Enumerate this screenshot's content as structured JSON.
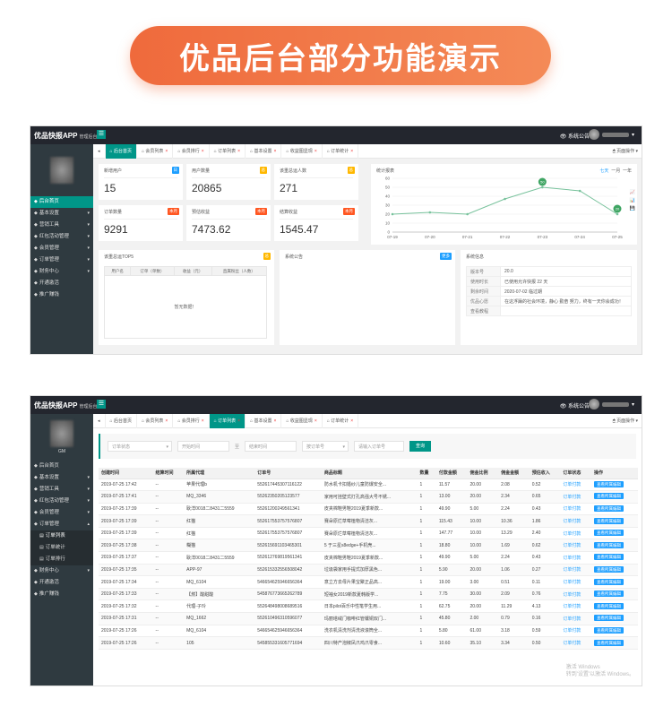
{
  "banner": {
    "title": "优品后台部分功能演示"
  },
  "app": {
    "brand": "优品快报APP",
    "brand_sub": "管理后台",
    "notice": "系统公告",
    "page_ops": "页面操作"
  },
  "sidebar1": {
    "items": [
      {
        "label": "后台首页",
        "active": true
      },
      {
        "label": "基本设置"
      },
      {
        "label": "营销工具"
      },
      {
        "label": "红包活动管理"
      },
      {
        "label": "会员管理"
      },
      {
        "label": "订单管理"
      },
      {
        "label": "财务中心"
      },
      {
        "label": "开通激活"
      },
      {
        "label": "推广赚钱"
      }
    ]
  },
  "tabs1": [
    {
      "label": "后台首页",
      "active": true
    },
    {
      "label": "会员列表"
    },
    {
      "label": "会员排行"
    },
    {
      "label": "订单列表"
    },
    {
      "label": "基本设置"
    },
    {
      "label": "收益图显现"
    },
    {
      "label": "订单统计"
    }
  ],
  "stats": [
    {
      "title": "新增用户",
      "badge": "日",
      "badge_color": "#1e9fff",
      "value": "15"
    },
    {
      "title": "用户数量",
      "badge": "总",
      "badge_color": "#ffb800",
      "value": "20865"
    },
    {
      "title": "该重总运人数",
      "badge": "总",
      "badge_color": "#ffb800",
      "value": "271"
    },
    {
      "title": "订单数量",
      "badge": "本月",
      "badge_color": "#ff5722",
      "value": "9291"
    },
    {
      "title": "预估收益",
      "badge": "本月",
      "badge_color": "#ff5722",
      "value": "7473.62"
    },
    {
      "title": "结算收益",
      "badge": "本月",
      "badge_color": "#ff5722",
      "value": "1545.47"
    }
  ],
  "chart_panel": {
    "title": "统计报表",
    "ranges": [
      "七天",
      "一月",
      "一年"
    ]
  },
  "chart_data": {
    "type": "line",
    "title": "",
    "x": [
      "07-19",
      "07-20",
      "07-21",
      "07-22",
      "07-23",
      "07-24",
      "07-25"
    ],
    "series": [
      {
        "values": [
          20,
          22,
          20,
          37,
          50,
          46,
          20
        ]
      }
    ],
    "point_labels": {
      "4": "50",
      "6": "20"
    },
    "ylim": [
      0,
      60
    ],
    "yticks": [
      0,
      10,
      20,
      30,
      40,
      50,
      60
    ],
    "grid": true,
    "color": "#78c29c"
  },
  "top5": {
    "title": "该重总运TOP5",
    "badge": "总",
    "columns": [
      "用户名",
      "订单（单数）",
      "收益（元）",
      "直属粉丝（人数）"
    ],
    "empty": "暂无数据！"
  },
  "notice_panel": {
    "title": "系统公告",
    "more": "更多"
  },
  "sys_info": {
    "title": "系统信息",
    "rows": [
      {
        "k": "版本号",
        "v": "20.0"
      },
      {
        "k": "使用时长",
        "v": "已使用允许快报 22 天",
        "red": "22 天"
      },
      {
        "k": "剩余时间",
        "v": "2020-07-02 临过期",
        "is_red": true
      },
      {
        "k": "优品心愿",
        "v": "在这浮躁的社会环境，静心 勤奋 努力，终有一天你会成功！"
      },
      {
        "k": "查看教程",
        "v": ""
      }
    ]
  },
  "sidebar2": {
    "user": "GM",
    "items": [
      {
        "label": "后台首页"
      },
      {
        "label": "基本设置"
      },
      {
        "label": "营销工具"
      },
      {
        "label": "红包活动管理"
      },
      {
        "label": "会员管理"
      },
      {
        "label": "订单管理",
        "open": true
      },
      {
        "label": "订单列表",
        "sub": true,
        "active": true
      },
      {
        "label": "订单统计",
        "sub": true
      },
      {
        "label": "订单排行",
        "sub": true
      },
      {
        "label": "财务中心"
      },
      {
        "label": "开通激活"
      },
      {
        "label": "推广赚钱"
      }
    ]
  },
  "tabs2": [
    {
      "label": "后台首页"
    },
    {
      "label": "会员列表"
    },
    {
      "label": "会员排行"
    },
    {
      "label": "订单列表",
      "active": true
    },
    {
      "label": "基本设置"
    },
    {
      "label": "收益图显现"
    },
    {
      "label": "订单统计"
    }
  ],
  "filters": {
    "status": "订单状态",
    "start": "开始时间",
    "sep": "至",
    "end": "结束时间",
    "order_no": "按订单号",
    "keyword_ph": "请输入订单号",
    "search": "查询"
  },
  "orders": {
    "columns": [
      "创建时间",
      "结算时间",
      "所属代理",
      "订单号",
      "商品标题",
      "数量",
      "付款金额",
      "佣金比例",
      "佣金金额",
      "预估收入",
      "订单状态",
      "操作"
    ],
    "rows": [
      [
        "2019-07-25 17:42",
        "--",
        "苹果代理b",
        "5526174453071161​22",
        "防水机卡扣婚纱儿童防爆安全...",
        "1",
        "11.57",
        "20.00",
        "2.08",
        "0.52",
        "订单付款",
        "查看所属编辑"
      ],
      [
        "2019-07-25 17:41",
        "--",
        "MQ_3346",
        "552623502051​23577",
        "家用可挂壁式打孔高强大号不锈...",
        "1",
        "13.00",
        "20.00",
        "2.34",
        "0.65",
        "订单付款",
        "查看所属编辑"
      ],
      [
        "2019-07-25 17:39",
        "--",
        "耿洋0018二8431二5559",
        "5526120024956​1341",
        "皮夹棉鞋男鞋2019夏季新款...",
        "1",
        "49.90",
        "5.00",
        "2.24",
        "0.43",
        "订单付款",
        "查看所属编辑"
      ],
      [
        "2019-07-25 17:39",
        "--",
        "红猫",
        "5526175537575​76807",
        "赛朵原烂草莓植物清洁灰...",
        "1",
        "115.43",
        "10.00",
        "10.36",
        "1.86",
        "订单付款",
        "查看所属编辑"
      ],
      [
        "2019-07-25 17:39",
        "--",
        "红猫",
        "5526175537575​76807",
        "赛朵原烂草莓植物清洁灰...",
        "1",
        "147.77",
        "10.00",
        "13.29",
        "2.40",
        "订单付款",
        "查看所属编辑"
      ],
      [
        "2019-07-25 17:38",
        "--",
        "糊猫",
        "5526156911034​65301",
        "5 于三星s8edge+手机壳...",
        "1",
        "18.80",
        "10.00",
        "1.69",
        "0.62",
        "订单付款",
        "查看所属编辑"
      ],
      [
        "2019-07-25 17:37",
        "--",
        "耿洋0018二8431二5559",
        "5526127698195​61341",
        "皮夹棉鞋男鞋2019夏季新款...",
        "1",
        "49.90",
        "5.00",
        "2.24",
        "0.43",
        "订单付款",
        "查看所属编辑"
      ],
      [
        "2019-07-25 17:35",
        "--",
        "APP-97",
        "5526153325565​08042",
        "垃圾袋家用手提式加厚黑色...",
        "1",
        "5.90",
        "20.00",
        "1.06",
        "0.27",
        "订单付款",
        "查看所属编辑"
      ],
      [
        "2019-07-25 17:34",
        "--",
        "MQ_6104",
        "5466546259466​56364",
        "意立方去母片果宝聚正品高...",
        "1",
        "19.00",
        "3.00",
        "0.51",
        "0.11",
        "订单付款",
        "查看所属编辑"
      ],
      [
        "2019-07-25 17:33",
        "--",
        "【燃】酸甜酸",
        "5458767736652​62789",
        "短袖女2019新款夏韩版学...",
        "1",
        "7.75",
        "30.00",
        "2.09",
        "0.76",
        "订单付款",
        "查看所属编辑"
      ],
      [
        "2019-07-25 17:32",
        "--",
        "代理-子玲",
        "5526484980086​89516",
        "日本pilot百乐中性笔学生用...",
        "1",
        "62.75",
        "20.00",
        "11.29",
        "4.13",
        "订单付款",
        "查看所属编辑"
      ],
      [
        "2019-07-25 17:31",
        "--",
        "MQ_1662",
        "5526104963105​96077",
        "玛丽塔绒门咖啡红管镶铜双门...",
        "1",
        "45.80",
        "2.00",
        "0.79",
        "0.16",
        "订单付款",
        "查看所属编辑"
      ],
      [
        "2019-07-25 17:26",
        "--",
        "MQ_6104",
        "5466546259466​56364",
        "洗衣机清洗剂清洗液滚筒全...",
        "1",
        "5.80",
        "61.00",
        "3.18",
        "0.59",
        "订单付款",
        "查看所属编辑"
      ],
      [
        "2019-07-25 17:26",
        "--",
        "105",
        "5458553316057​71694",
        "四川特产泡椒凤爪鸡爪零食...",
        "1",
        "10.60",
        "35.10",
        "3.34",
        "0.50",
        "订单付款",
        "查看所属编辑"
      ]
    ]
  },
  "watermark": {
    "line1": "激活 Windows",
    "line2": "转到'设置'以激活 Windows。"
  }
}
